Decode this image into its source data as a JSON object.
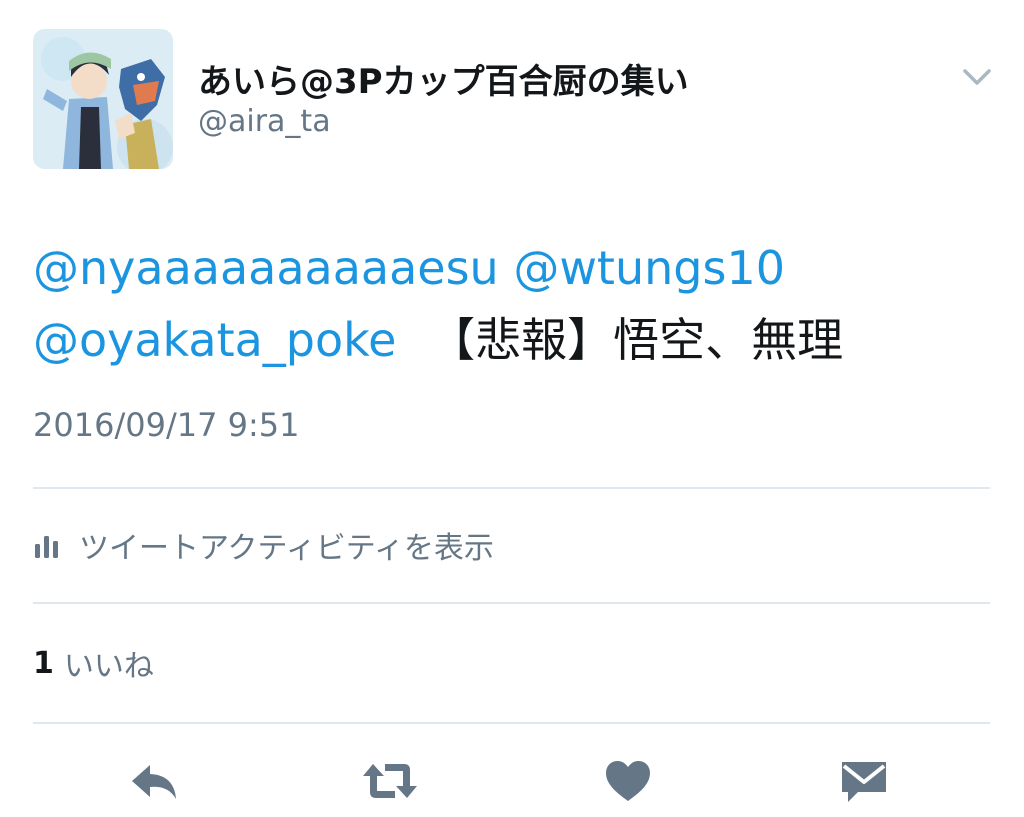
{
  "tweet": {
    "author": {
      "display_name": "あいら@3Pカップ百合厨の集い",
      "handle": "@aira_ta",
      "avatar": "avatar"
    },
    "menu_icon": "chevron-down-icon",
    "text": {
      "mentions": [
        "@nyaaaaaaaaaaesu",
        "@wtungs10",
        "@oyakata_poke"
      ],
      "body": "【悲報】悟空、無理"
    },
    "timestamp": "2016/09/17 9:51",
    "activity": {
      "icon": "analytics-icon",
      "label": "ツイートアクティビティを表示"
    },
    "likes": {
      "count": "1",
      "label": "いいね"
    },
    "actions": [
      {
        "name": "reply",
        "icon": "reply-icon"
      },
      {
        "name": "retweet",
        "icon": "retweet-icon"
      },
      {
        "name": "like",
        "icon": "heart-icon"
      },
      {
        "name": "direct-message",
        "icon": "envelope-icon"
      }
    ],
    "colors": {
      "link": "#1b95e0",
      "secondary_text": "#657786",
      "action_icon": "#657786",
      "divider": "#e1e8ed",
      "primary_text": "#14171a"
    }
  }
}
